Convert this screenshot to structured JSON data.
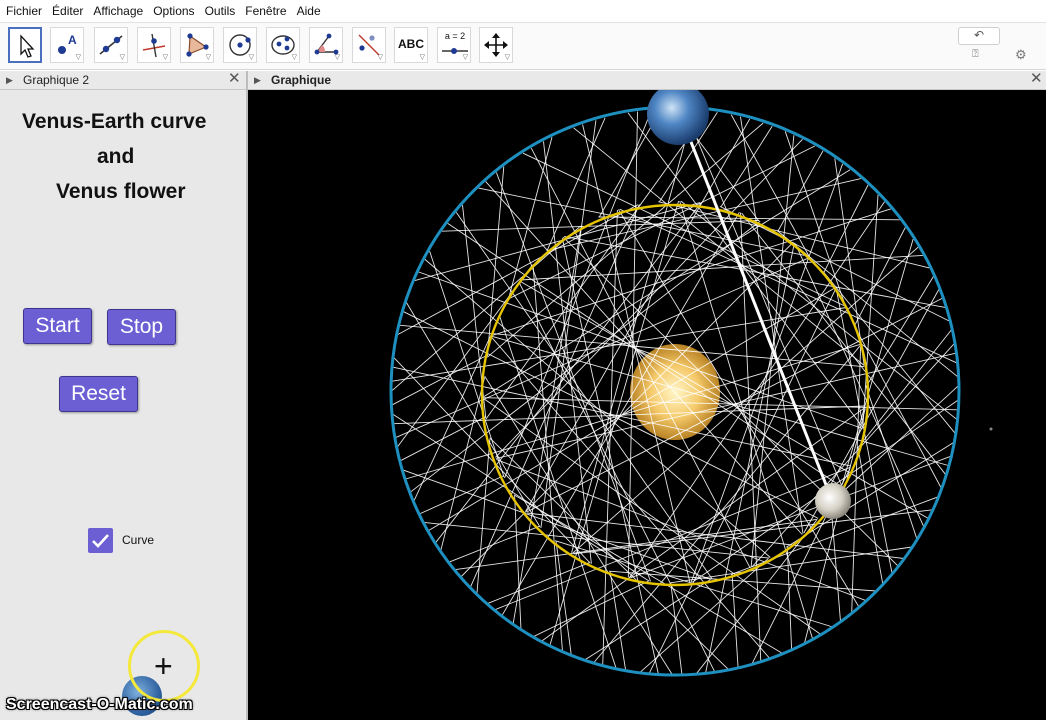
{
  "menu": [
    "Fichier",
    "Éditer",
    "Affichage",
    "Options",
    "Outils",
    "Fenêtre",
    "Aide"
  ],
  "toolbar": {
    "tools": [
      {
        "name": "move-tool-button",
        "icon": "cursor-arrow-icon",
        "selected": true
      },
      {
        "name": "point-tool-button",
        "icon": "point-a-icon"
      },
      {
        "name": "line-tool-button",
        "icon": "line-through-points-icon"
      },
      {
        "name": "perpendicular-tool-button",
        "icon": "perpendicular-line-icon"
      },
      {
        "name": "polygon-tool-button",
        "icon": "polygon-icon"
      },
      {
        "name": "circle-tool-button",
        "icon": "circle-center-point-icon"
      },
      {
        "name": "ellipse-tool-button",
        "icon": "ellipse-icon"
      },
      {
        "name": "angle-tool-button",
        "icon": "angle-icon"
      },
      {
        "name": "reflect-tool-button",
        "icon": "reflect-line-icon"
      },
      {
        "name": "text-tool-button",
        "icon": "text-abc-icon",
        "label": "ABC"
      },
      {
        "name": "slider-tool-button",
        "icon": "slider-icon",
        "label": "a = 2"
      },
      {
        "name": "move-view-tool-button",
        "icon": "move-graphics-view-icon"
      }
    ],
    "undo_icon": "undo-icon",
    "help_icon": "help-icon",
    "settings_icon": "gear-icon"
  },
  "left_view": {
    "title": "Graphique 2",
    "heading": [
      "Venus-Earth curve",
      "and",
      "Venus flower"
    ],
    "buttons": {
      "start": "Start",
      "stop": "Stop",
      "reset": "Reset"
    },
    "checkbox": {
      "label": "Curve",
      "checked": true
    }
  },
  "right_view": {
    "title": "Graphique"
  },
  "watermark": "Screencast-O-Matic.com",
  "colors": {
    "button": "#6c5fd4",
    "earth_orbit": "#1e90c0",
    "venus_orbit": "#e6c400",
    "background": "#000000",
    "curve": "#ffffff"
  }
}
